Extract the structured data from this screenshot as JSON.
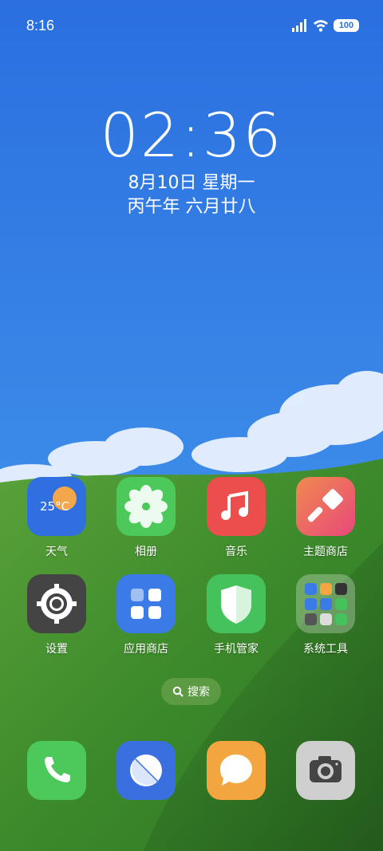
{
  "status_bar": {
    "time": "8:16",
    "battery": "100"
  },
  "clock": {
    "time": "02:36",
    "date": "8月10日 星期一",
    "lunar": "丙午年 六月廿八"
  },
  "apps": [
    {
      "name": "weather",
      "label": "天气",
      "temp": "25°C",
      "color": "#2f6fe0"
    },
    {
      "name": "gallery",
      "label": "相册",
      "color": "#4cc95a"
    },
    {
      "name": "music",
      "label": "音乐",
      "color": "#ec4d4d"
    },
    {
      "name": "themes",
      "label": "主题商店",
      "color": "#ea5a5a"
    },
    {
      "name": "settings",
      "label": "设置",
      "color": "#444444"
    },
    {
      "name": "app-store",
      "label": "应用商店",
      "color": "#3a7be8"
    },
    {
      "name": "security",
      "label": "手机管家",
      "color": "#46c25d"
    },
    {
      "name": "system-tools",
      "label": "系统工具",
      "color": "rgba(255,255,255,0.3)"
    }
  ],
  "search": {
    "label": "搜索"
  },
  "dock": [
    {
      "name": "phone",
      "icon": "phone-icon",
      "color": "#4cc95a"
    },
    {
      "name": "browser",
      "icon": "browser-icon",
      "color": "#3a6fe0"
    },
    {
      "name": "messages",
      "icon": "chat-bubble-icon",
      "color": "#f3a540"
    },
    {
      "name": "camera",
      "icon": "camera-icon",
      "color": "#cfcfcf"
    }
  ]
}
